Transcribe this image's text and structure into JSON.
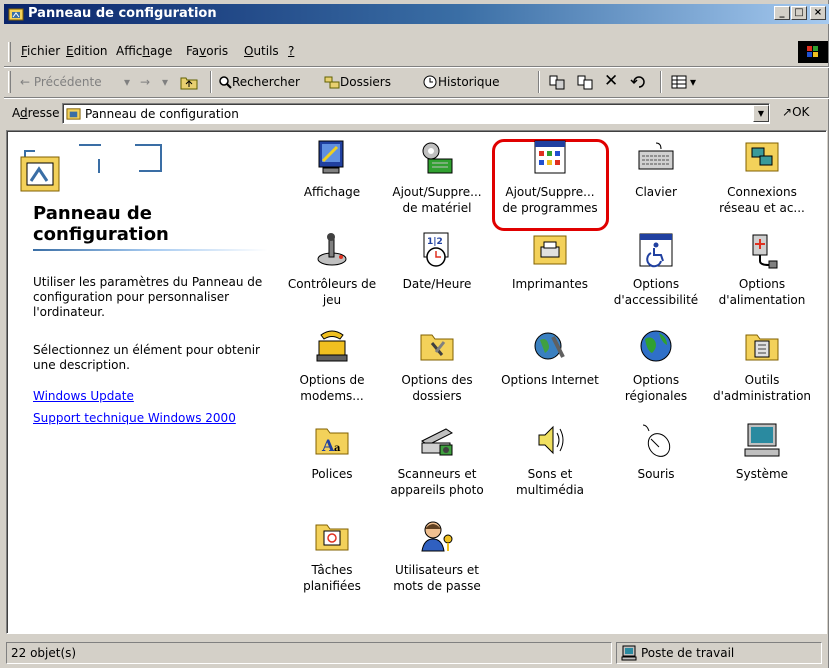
{
  "window": {
    "title": "Panneau de configuration"
  },
  "menu": {
    "items": [
      {
        "pre": "",
        "key": "F",
        "post": "ichier"
      },
      {
        "pre": "",
        "key": "E",
        "post": "dition"
      },
      {
        "pre": "Affic",
        "key": "h",
        "post": "age"
      },
      {
        "pre": "Fa",
        "key": "v",
        "post": "oris"
      },
      {
        "pre": "",
        "key": "O",
        "post": "utils"
      },
      {
        "pre": "",
        "key": "?",
        "post": ""
      }
    ]
  },
  "toolbar": {
    "back": "← Précédente",
    "search": "Rechercher",
    "folders": "Dossiers",
    "history": "Historique"
  },
  "address": {
    "label_pre": "A",
    "label_key": "d",
    "label_post": "resse",
    "value": "Panneau de configuration",
    "go": "OK"
  },
  "panel": {
    "title": "Panneau de configuration",
    "description": "Utiliser les paramètres du Panneau de configuration pour personnaliser l'ordinateur.",
    "hint": "Sélectionnez un élément pour obtenir une description.",
    "links": [
      "Windows Update",
      "Support technique Windows 2000"
    ]
  },
  "items": [
    {
      "line1": "Affichage",
      "line2": "",
      "icon": "display-icon"
    },
    {
      "line1": "Ajout/Suppre...",
      "line2": "de matériel",
      "icon": "add-hardware-icon"
    },
    {
      "line1": "Ajout/Suppre...",
      "line2": "de programmes",
      "icon": "add-remove-programs-icon"
    },
    {
      "line1": "Clavier",
      "line2": "",
      "icon": "keyboard-icon"
    },
    {
      "line1": "Connexions",
      "line2": "réseau et ac...",
      "icon": "network-connections-icon"
    },
    {
      "line1": "Contrôleurs de",
      "line2": "jeu",
      "icon": "game-controllers-icon"
    },
    {
      "line1": "Date/Heure",
      "line2": "",
      "icon": "date-time-icon"
    },
    {
      "line1": "Imprimantes",
      "line2": "",
      "icon": "printers-icon"
    },
    {
      "line1": "Options",
      "line2": "d'accessibilité",
      "icon": "accessibility-icon"
    },
    {
      "line1": "Options",
      "line2": "d'alimentation",
      "icon": "power-options-icon"
    },
    {
      "line1": "Options de",
      "line2": "modems...",
      "icon": "modem-icon"
    },
    {
      "line1": "Options des",
      "line2": "dossiers",
      "icon": "folder-options-icon"
    },
    {
      "line1": "Options Internet",
      "line2": "",
      "icon": "internet-options-icon"
    },
    {
      "line1": "Options",
      "line2": "régionales",
      "icon": "regional-options-icon"
    },
    {
      "line1": "Outils",
      "line2": "d'administration",
      "icon": "admin-tools-icon"
    },
    {
      "line1": "Polices",
      "line2": "",
      "icon": "fonts-icon"
    },
    {
      "line1": "Scanneurs et",
      "line2": "appareils photo",
      "icon": "scanner-icon"
    },
    {
      "line1": "Sons et",
      "line2": "multimédia",
      "icon": "sounds-icon"
    },
    {
      "line1": "Souris",
      "line2": "",
      "icon": "mouse-icon"
    },
    {
      "line1": "Système",
      "line2": "",
      "icon": "system-icon"
    },
    {
      "line1": "Tâches",
      "line2": "planifiées",
      "icon": "scheduled-tasks-icon"
    },
    {
      "line1": "Utilisateurs et",
      "line2": "mots de passe",
      "icon": "users-passwords-icon"
    }
  ],
  "status": {
    "count": "22 objet(s)",
    "location": "Poste de travail"
  },
  "colors": {
    "title_bar": "#0a246a",
    "chrome": "#d4d0c8",
    "link": "#0000ff",
    "highlight": "#e00000"
  }
}
